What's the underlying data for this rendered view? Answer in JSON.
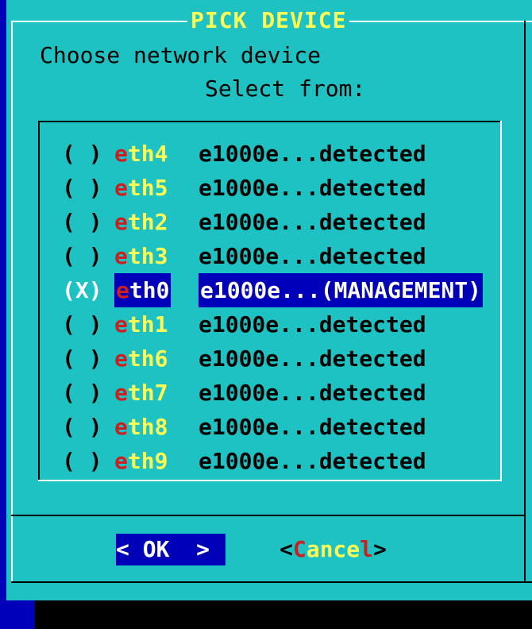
{
  "dialog": {
    "title": "PICK DEVICE",
    "prompt": "Choose network device",
    "subprompt": "Select from:"
  },
  "devices": [
    {
      "mark": "( )",
      "hot": "e",
      "rest": "th4",
      "desc": "e1000e...detected",
      "selected": false
    },
    {
      "mark": "( )",
      "hot": "e",
      "rest": "th5",
      "desc": "e1000e...detected",
      "selected": false
    },
    {
      "mark": "( )",
      "hot": "e",
      "rest": "th2",
      "desc": "e1000e...detected",
      "selected": false
    },
    {
      "mark": "( )",
      "hot": "e",
      "rest": "th3",
      "desc": "e1000e...detected",
      "selected": false
    },
    {
      "mark": "(X)",
      "hot": "e",
      "rest": "th0",
      "desc": "e1000e...(MANAGEMENT)",
      "selected": true
    },
    {
      "mark": "( )",
      "hot": "e",
      "rest": "th1",
      "desc": "e1000e...detected",
      "selected": false
    },
    {
      "mark": "( )",
      "hot": "e",
      "rest": "th6",
      "desc": "e1000e...detected",
      "selected": false
    },
    {
      "mark": "( )",
      "hot": "e",
      "rest": "th7",
      "desc": "e1000e...detected",
      "selected": false
    },
    {
      "mark": "( )",
      "hot": "e",
      "rest": "th8",
      "desc": "e1000e...detected",
      "selected": false
    },
    {
      "mark": "( )",
      "hot": "e",
      "rest": "th9",
      "desc": "e1000e...detected",
      "selected": false
    }
  ],
  "buttons": {
    "ok": {
      "left": "<",
      "label": " OK ",
      "right": ">"
    },
    "cancel": {
      "left": "<",
      "hot": "C",
      "rest": "ance",
      "tail": "l",
      "right": ">"
    }
  },
  "colors": {
    "background": "#0000b8",
    "dialog": "#1ec2c2",
    "title": "#ffff55",
    "hotkey": "#cc2020",
    "highlight": "#0000b8"
  }
}
